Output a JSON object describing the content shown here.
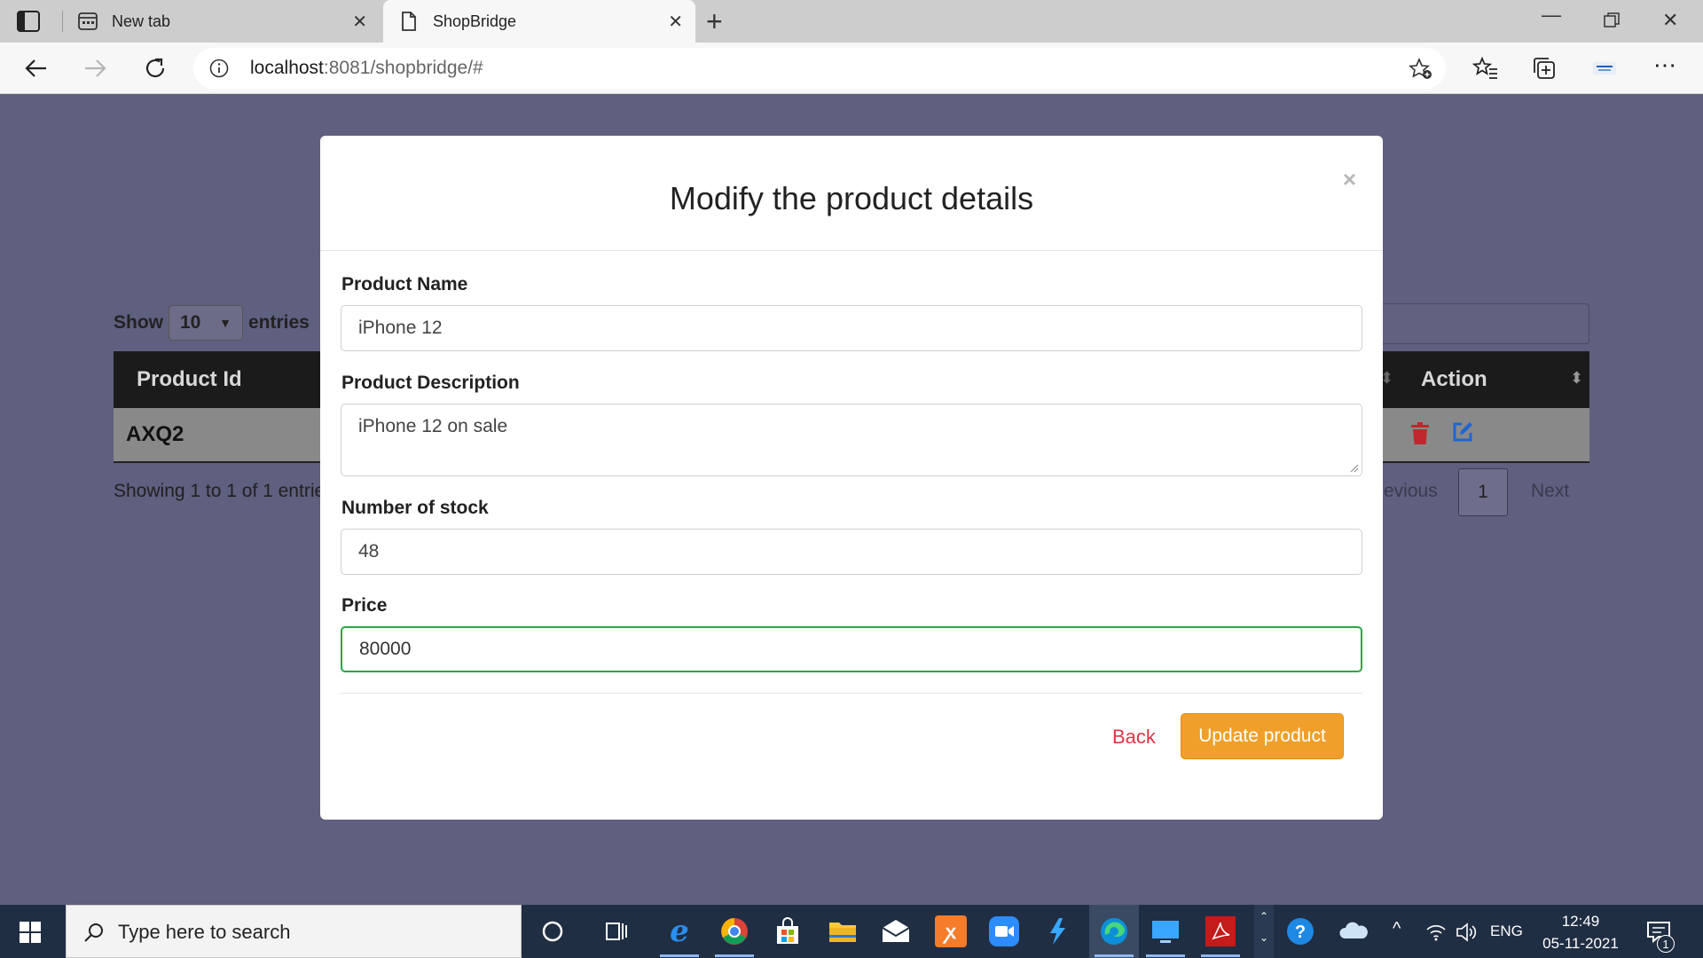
{
  "browser": {
    "tabs": [
      {
        "label": "New tab"
      },
      {
        "label": "ShopBridge"
      }
    ],
    "url_host": "localhost",
    "url_path": ":8081/shopbridge/#"
  },
  "background": {
    "show_label": "Show",
    "entries_value": "10",
    "entries_label": "entries",
    "columns": {
      "product_id": "Product Id",
      "action": "Action"
    },
    "row": {
      "product_id": "AXQ2"
    },
    "info": "Showing 1 to 1 of 1 entrie",
    "prev": "evious",
    "page": "1",
    "next": "Next"
  },
  "modal": {
    "title": "Modify the product details",
    "close": "×",
    "fields": {
      "name_label": "Product Name",
      "name_value": "iPhone 12",
      "desc_label": "Product Description",
      "desc_value": "iPhone 12 on sale",
      "stock_label": "Number of stock",
      "stock_value": "48",
      "price_label": "Price",
      "price_value": "80000"
    },
    "back_label": "Back",
    "update_label": "Update product"
  },
  "taskbar": {
    "search_placeholder": "Type here to search",
    "language": "ENG",
    "time": "12:49",
    "date": "05-11-2021",
    "notification_count": "1"
  },
  "colors": {
    "overlay": "#5f5f7f",
    "update_button": "#f0a02a",
    "back_link": "#dc3545",
    "focus_border": "#28a745",
    "delete_icon": "#c0282d",
    "edit_icon": "#1f66d1"
  }
}
